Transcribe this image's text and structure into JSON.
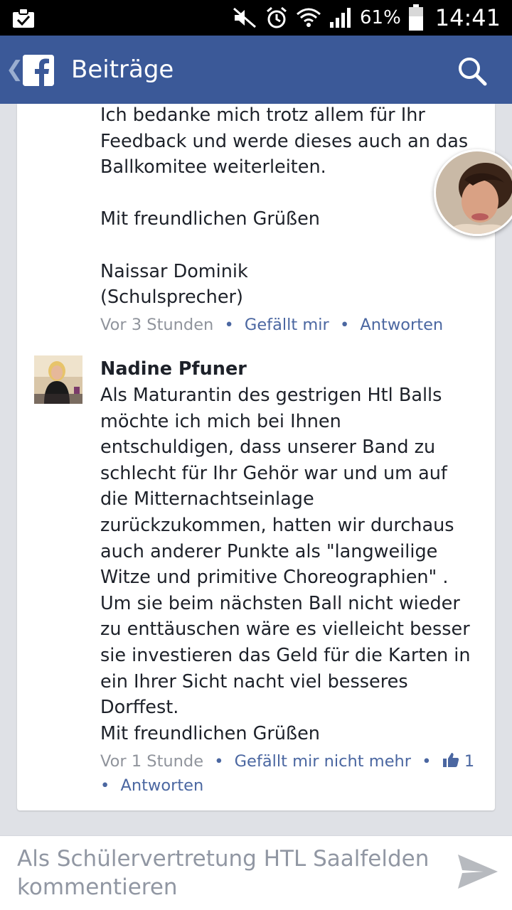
{
  "status_bar": {
    "battery_percent": "61%",
    "time": "14:41"
  },
  "app_bar": {
    "title": "Beiträge"
  },
  "comments": [
    {
      "lines": [
        "Ich bedanke mich trotz allem für Ihr",
        "Feedback  und werde dieses auch an das",
        "Ballkomitee weiterleiten.",
        "",
        "Mit freundlichen Grüßen",
        "",
        "Naissar Dominik",
        "(Schulsprecher)"
      ],
      "time": "Vor 3 Stunden",
      "like_label": "Gefällt mir",
      "reply_label": "Antworten"
    },
    {
      "author": "Nadine Pfuner",
      "lines": [
        "Als Maturantin des gestrigen Htl Balls",
        "möchte ich mich bei Ihnen",
        "entschuldigen, dass unserer Band zu",
        "schlecht für Ihr Gehör war und um auf",
        "die Mitternachtseinlage",
        "zurückzukommen, hatten wir durchaus",
        "auch anderer Punkte als \"langweilige",
        "Witze und primitive Choreographien\" .",
        "Um sie beim nächsten  Ball nicht wieder",
        "zu enttäuschen wäre es vielleicht besser",
        "sie investieren das Geld für die Karten in",
        "ein Ihrer Sicht nacht viel besseres",
        "Dorffest.",
        "Mit freundlichen Grüßen"
      ],
      "time": "Vor 1 Stunde",
      "like_label": "Gefällt mir nicht mehr",
      "like_count": "1",
      "reply_label": "Antworten"
    }
  ],
  "composer": {
    "placeholder": "Als Schülervertretung HTL Saalfelden kommentieren"
  },
  "colors": {
    "brand_blue": "#3b5998",
    "link_blue": "#4b67a1",
    "meta_gray": "#90949c",
    "text": "#1d2129"
  }
}
